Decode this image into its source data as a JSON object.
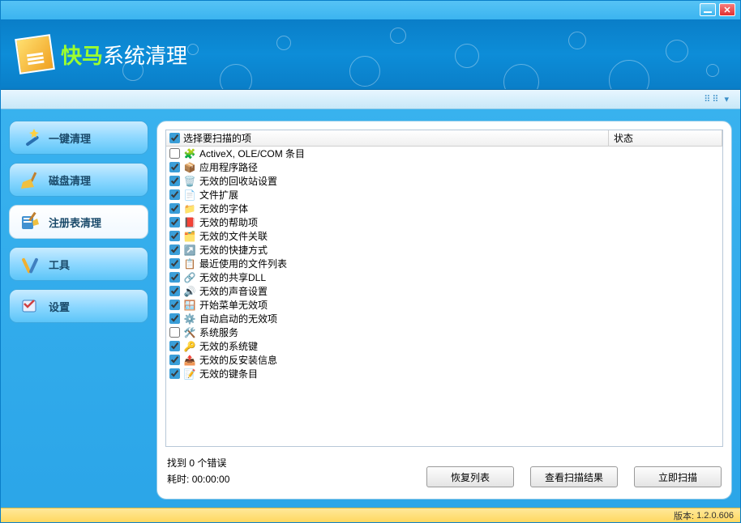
{
  "header": {
    "title_green": "快马",
    "title_white": "系统清理"
  },
  "sidebar": {
    "items": [
      {
        "label": "一键清理",
        "icon": "wand-icon"
      },
      {
        "label": "磁盘清理",
        "icon": "broom-icon"
      },
      {
        "label": "注册表清理",
        "icon": "registry-icon"
      },
      {
        "label": "工具",
        "icon": "tools-icon"
      },
      {
        "label": "设置",
        "icon": "settings-icon"
      }
    ]
  },
  "list": {
    "header_select": "选择要扫描的项",
    "header_status": "状态",
    "header_checked": true,
    "items": [
      {
        "checked": false,
        "icon": "🧩",
        "label": "ActiveX, OLE/COM 条目"
      },
      {
        "checked": true,
        "icon": "📦",
        "label": "应用程序路径"
      },
      {
        "checked": true,
        "icon": "🗑️",
        "label": "无效的回收站设置"
      },
      {
        "checked": true,
        "icon": "📄",
        "label": "文件扩展"
      },
      {
        "checked": true,
        "icon": "📁",
        "label": "无效的字体"
      },
      {
        "checked": true,
        "icon": "📕",
        "label": "无效的帮助项"
      },
      {
        "checked": true,
        "icon": "🗂️",
        "label": "无效的文件关联"
      },
      {
        "checked": true,
        "icon": "↗️",
        "label": "无效的快捷方式"
      },
      {
        "checked": true,
        "icon": "📋",
        "label": "最近使用的文件列表"
      },
      {
        "checked": true,
        "icon": "🔗",
        "label": "无效的共享DLL"
      },
      {
        "checked": true,
        "icon": "🔊",
        "label": "无效的声音设置"
      },
      {
        "checked": true,
        "icon": "🪟",
        "label": "开始菜单无效项"
      },
      {
        "checked": true,
        "icon": "⚙️",
        "label": "自动启动的无效项"
      },
      {
        "checked": false,
        "icon": "🛠️",
        "label": "系统服务"
      },
      {
        "checked": true,
        "icon": "🔑",
        "label": "无效的系统键"
      },
      {
        "checked": true,
        "icon": "📤",
        "label": "无效的反安装信息"
      },
      {
        "checked": true,
        "icon": "📝",
        "label": "无效的键条目"
      }
    ]
  },
  "status": {
    "found_label": "找到 0 个错误",
    "elapsed_label": "耗时:",
    "elapsed_value": "00:00:00"
  },
  "buttons": {
    "restore": "恢复列表",
    "view_results": "查看扫描结果",
    "scan_now": "立即扫描"
  },
  "footer": {
    "version_label": "版本:",
    "version_value": "1.2.0.606"
  }
}
